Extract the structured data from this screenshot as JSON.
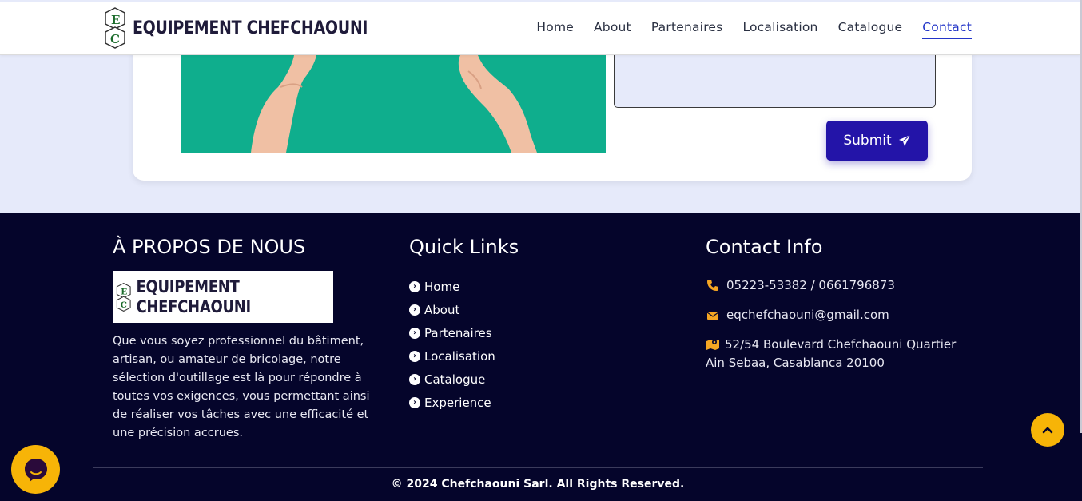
{
  "header": {
    "logo_text": "EQUIPEMENT CHEFCHAOUNI",
    "nav": [
      {
        "label": "Home",
        "active": false
      },
      {
        "label": "About",
        "active": false
      },
      {
        "label": "Partenaires",
        "active": false
      },
      {
        "label": "Localisation",
        "active": false
      },
      {
        "label": "Catalogue",
        "active": false
      },
      {
        "label": "Contact",
        "active": true
      }
    ]
  },
  "form": {
    "message_value": "",
    "submit_label": "Submit"
  },
  "footer": {
    "about": {
      "title": "À PROPOS DE NOUS",
      "logo_text": "EQUIPEMENT CHEFCHAOUNI",
      "text": "Que vous soyez professionnel du bâtiment, artisan, ou amateur de bricolage, notre sélection d'outillage est là pour répondre à toutes vos exigences, vous permettant ainsi de réaliser vos tâches avec une efficacité et une précision accrues."
    },
    "links": {
      "title": "Quick Links",
      "items": [
        "Home",
        "About",
        "Partenaires",
        "Localisation",
        "Catalogue",
        "Experience"
      ]
    },
    "contact": {
      "title": "Contact Info",
      "phone": "05223-53382 / 0661796873",
      "email": "eqchefchaouni@gmail.com",
      "address": "52/54 Boulevard Chefchaouni Quartier Ain Sebaa, Casablanca 20100"
    },
    "copyright": "© 2024 Chefchaouni Sarl. All Rights Reserved."
  },
  "colors": {
    "accent": "#2335c8",
    "submit": "#2314a8",
    "footer_bg": "#05052b",
    "yellow": "#f7b407",
    "photo_bg": "#0fae8d"
  },
  "icons": {
    "phone": "phone-icon",
    "email": "envelope-icon",
    "address": "map-icon",
    "submit": "paper-plane-icon",
    "scroll_top": "chevron-up-icon",
    "chat": "chat-icon"
  }
}
